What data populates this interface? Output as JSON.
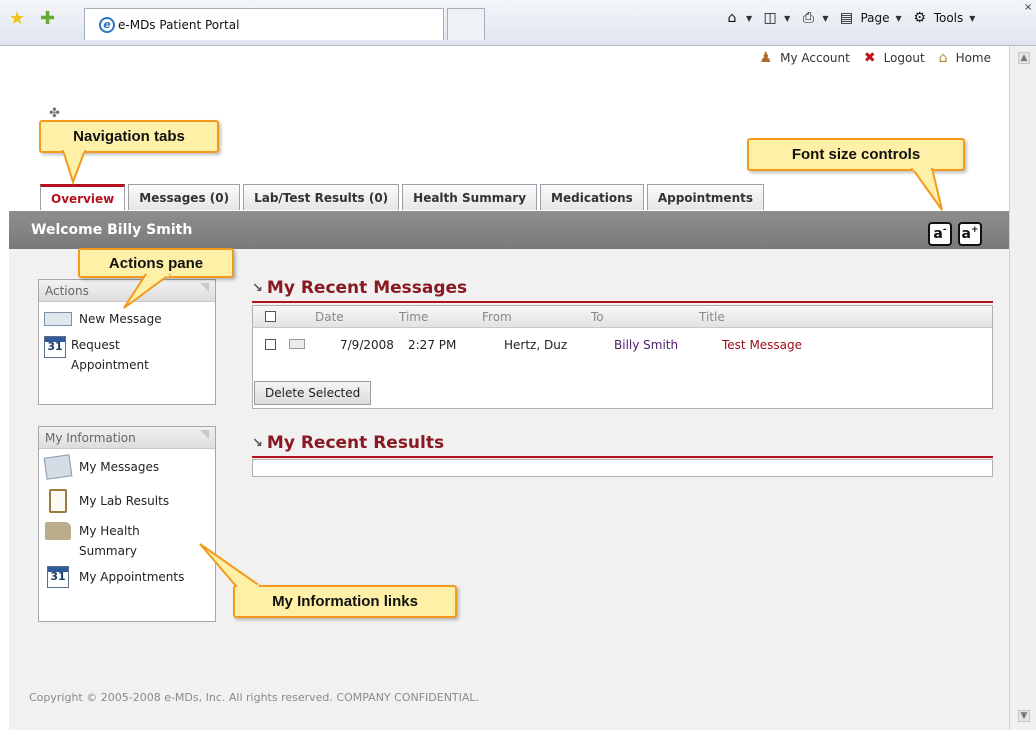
{
  "browser": {
    "tab_title": "e-MDs Patient Portal",
    "commands": [
      "Page",
      "Tools"
    ]
  },
  "header": {
    "links": [
      "My Account",
      "Logout",
      "Home"
    ]
  },
  "tabs": [
    {
      "label": "Overview",
      "active": true
    },
    {
      "label": "Messages (0)"
    },
    {
      "label": "Lab/Test Results (0)"
    },
    {
      "label": "Health Summary"
    },
    {
      "label": "Medications"
    },
    {
      "label": "Appointments"
    }
  ],
  "welcome": "Welcome Billy Smith",
  "font_controls": {
    "decrease": "a",
    "increase": "a",
    "minus": "-",
    "plus": "+"
  },
  "actions_panel": {
    "title": "Actions",
    "items": [
      {
        "label": "New Message",
        "icon": "envelope-icon"
      },
      {
        "label": "Request Appointment",
        "icon": "calendar-add-icon",
        "cal_day": "31"
      }
    ]
  },
  "info_panel": {
    "title": "My Information",
    "items": [
      {
        "label": "My Messages",
        "icon": "messages-icon"
      },
      {
        "label": "My Lab Results",
        "icon": "clipboard-icon"
      },
      {
        "label": "My Health Summary",
        "icon": "folder-icon"
      },
      {
        "label": "My Appointments",
        "icon": "calendar-icon",
        "cal_day": "31"
      }
    ]
  },
  "recent_messages": {
    "title": "My Recent Messages",
    "columns": [
      "Date",
      "Time",
      "From",
      "To",
      "Title"
    ],
    "rows": [
      {
        "date": "7/9/2008",
        "time": "2:27 PM",
        "from": "Hertz, Duz",
        "to": "Billy Smith",
        "title": "Test Message"
      }
    ],
    "delete_button": "Delete Selected"
  },
  "recent_results": {
    "title": "My Recent Results"
  },
  "copyright": "Copyright © 2005-2008 e-MDs, Inc. All rights reserved. COMPANY CONFIDENTIAL.",
  "callouts": {
    "nav_tabs": "Navigation tabs",
    "font_size": "Font size controls",
    "actions_pane": "Actions pane",
    "my_info_links": "My Information links"
  },
  "colors": {
    "accent": "#b2121e",
    "callout_fill": "#fff0a8",
    "callout_border": "#f39a1e",
    "welcome_bar": "#858585"
  }
}
